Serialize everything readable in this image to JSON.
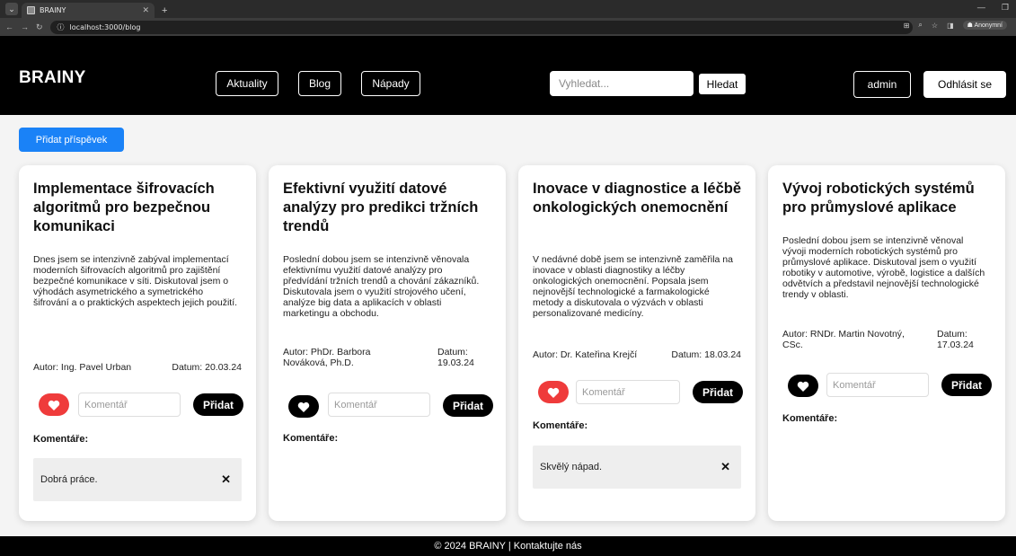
{
  "browser": {
    "tab_title": "BRAINY",
    "url": "localhost:3000/blog",
    "profile": "Anonymní",
    "icons": [
      "tab-search-icon",
      "favicon-icon",
      "close-icon",
      "new-tab-icon",
      "minimize-icon",
      "maximize-icon",
      "back-icon",
      "forward-icon",
      "reload-icon",
      "site-info-icon",
      "translate-icon",
      "zoom-icon",
      "star-icon",
      "sidebar-icon",
      "incognito-icon"
    ]
  },
  "header": {
    "brand": "BRAINY",
    "nav": [
      "Aktuality",
      "Blog",
      "Nápady"
    ],
    "search_placeholder": "Vyhledat...",
    "search_button": "Hledat",
    "user": "admin",
    "logout": "Odhlásit se"
  },
  "add_post": "Přidat příspěvek",
  "comment_placeholder": "Komentář",
  "add_comment": "Přidat",
  "comments_title": "Komentáře:",
  "posts": [
    {
      "title": "Implementace šifrovacích algoritmů pro bezpečnou komunikaci",
      "body": "Dnes jsem se intenzivně zabýval implementací moderních šifrovacích algoritmů pro zajištění bezpečné komunikace v síti. Diskutoval jsem o výhodách asymetrického a symetrického šifrování a o praktických aspektech jejich použití.",
      "author": "Autor: Ing. Pavel Urban",
      "date": "Datum: 20.03.24",
      "liked": true,
      "comments": [
        "Dobrá práce."
      ]
    },
    {
      "title": "Efektivní využití datové analýzy pro predikci tržních trendů",
      "body": "Poslední dobou jsem se intenzivně věnovala efektivnímu využití datové analýzy pro předvídání tržních trendů a chování zákazníků. Diskutovala jsem o využití strojového učení, analýze big data a aplikacích v oblasti marketingu a obchodu.",
      "author": "Autor: PhDr. Barbora Nováková, Ph.D.",
      "date": "Datum: 19.03.24",
      "liked": false,
      "comments": []
    },
    {
      "title": "Inovace v diagnostice a léčbě onkologických onemocnění",
      "body": "V nedávné době jsem se intenzivně zaměřila na inovace v oblasti diagnostiky a léčby onkologických onemocnění. Popsala jsem nejnovější technologické a farmakologické metody a diskutovala o výzvách v oblasti personalizované medicíny.",
      "author": "Autor: Dr. Kateřina Krejčí",
      "date": "Datum: 18.03.24",
      "liked": true,
      "comments": [
        "Skvělý nápad."
      ]
    },
    {
      "title": "Vývoj robotických systémů pro průmyslové aplikace",
      "body": "Poslední dobou jsem se intenzivně věnoval vývoji moderních robotických systémů pro průmyslové aplikace. Diskutoval jsem o využití robotiky v automotive, výrobě, logistice a dalších odvětvích a představil nejnovější technologické trendy v oblasti.",
      "author": "Autor: RNDr. Martin Novotný, CSc.",
      "date": "Datum: 17.03.24",
      "liked": false,
      "comments": []
    }
  ],
  "footer": "© 2024 BRAINY | Kontaktujte nás"
}
